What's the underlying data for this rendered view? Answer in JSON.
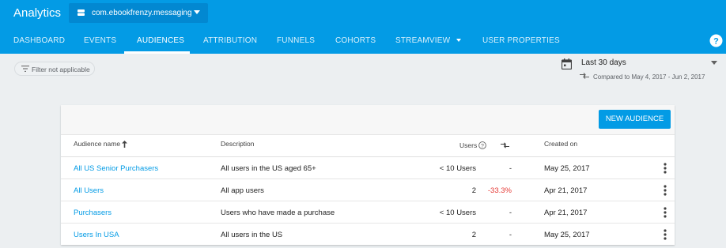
{
  "header": {
    "app_title": "Analytics",
    "app_selector": "com.ebookfrenzy.messaging",
    "tabs": [
      {
        "label": "DASHBOARD"
      },
      {
        "label": "EVENTS"
      },
      {
        "label": "AUDIENCES",
        "active": true
      },
      {
        "label": "ATTRIBUTION"
      },
      {
        "label": "FUNNELS"
      },
      {
        "label": "COHORTS"
      },
      {
        "label": "STREAMVIEW"
      },
      {
        "label": "USER PROPERTIES"
      }
    ],
    "colors": {
      "bar": "#039be5",
      "picker": "#0288d1"
    }
  },
  "filter": {
    "label": "Filter not applicable"
  },
  "date_range": {
    "value": "Last 30 days",
    "comparison": "Compared to May 4, 2017 - Jun 2, 2017"
  },
  "table": {
    "new_audience_label": "NEW AUDIENCE",
    "columns": {
      "name": "Audience name",
      "description": "Description",
      "users": "Users",
      "created": "Created on"
    },
    "rows": [
      {
        "name": "All US Senior Purchasers",
        "description": "All users in the US aged 65+",
        "users": "< 10 Users",
        "change": "-",
        "created": "May 25, 2017"
      },
      {
        "name": "All Users",
        "description": "All app users",
        "users": "2",
        "change": "-33.3%",
        "created": "Apr 21, 2017"
      },
      {
        "name": "Purchasers",
        "description": "Users who have made a purchase",
        "users": "< 10 Users",
        "change": "-",
        "created": "Apr 21, 2017"
      },
      {
        "name": "Users In USA",
        "description": "All users in the US",
        "users": "2",
        "change": "-",
        "created": "May 25, 2017"
      }
    ],
    "colors": {
      "link": "#039be5",
      "negative": "#e53935"
    }
  },
  "icons": [
    "app-icon",
    "dropdown-caret-icon",
    "help-icon",
    "filter-icon",
    "calendar-icon",
    "compare-icon",
    "sort-up-arrow-icon",
    "question-circle-icon",
    "more-vert-icon"
  ]
}
